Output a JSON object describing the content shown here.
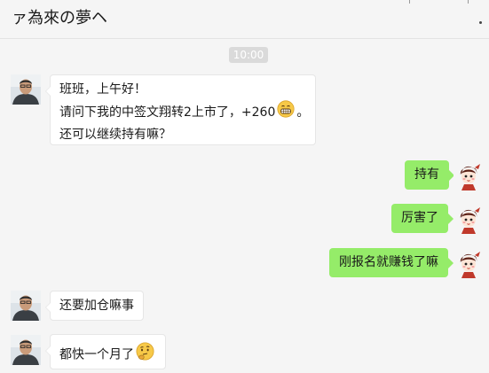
{
  "header": {
    "title": "ァ為來の夢ヘ"
  },
  "timestamp": "10:00",
  "colors": {
    "outgoing_bubble": "#95ec69",
    "incoming_bubble": "#ffffff",
    "background": "#f5f5f5"
  },
  "messages": [
    {
      "sender": "contact",
      "lines": [
        "班班，上午好！",
        "请问下我的中签文翔转2上市了，+260",
        "。",
        "还可以继续持有嘛？"
      ],
      "emoji": "grinning-face-emoji"
    },
    {
      "sender": "me",
      "text": "持有"
    },
    {
      "sender": "me",
      "text": "厉害了"
    },
    {
      "sender": "me",
      "text": "刚报名就赚钱了嘛"
    },
    {
      "sender": "contact",
      "text": "还要加仓嘛事"
    },
    {
      "sender": "contact",
      "text": "都快一个月了",
      "emoji": "thinking-face-emoji"
    }
  ]
}
